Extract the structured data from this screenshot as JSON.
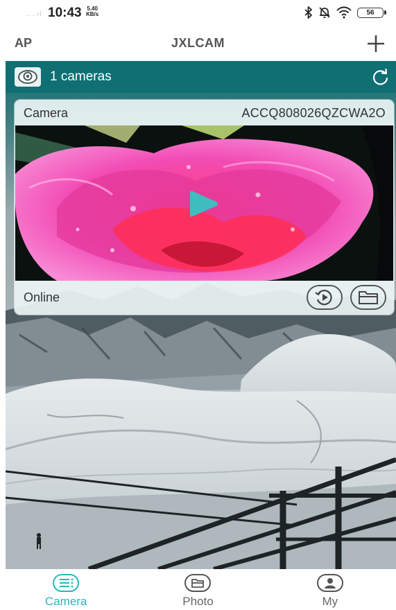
{
  "status_bar": {
    "signal": "....ıl",
    "time": "10:43",
    "speed_value": "5.40",
    "speed_unit": "KB/s",
    "battery": "56"
  },
  "header": {
    "left_label": "AP",
    "title": "JXLCAM",
    "add_icon": "plus-icon"
  },
  "banner": {
    "camera_icon": "camera-icon",
    "count_label": "1 cameras",
    "refresh_icon": "refresh-icon"
  },
  "camera_card": {
    "name": "Camera",
    "device_id": "ACCQ808026QZCWA2O",
    "status": "Online",
    "play_icon": "play-icon",
    "playback_icon": "playback-icon",
    "files_icon": "folder-icon"
  },
  "bottom_nav": {
    "items": [
      {
        "label": "Camera",
        "icon": "camera-list-icon",
        "active": true
      },
      {
        "label": "Photo",
        "icon": "photo-folder-icon",
        "active": false
      },
      {
        "label": "My",
        "icon": "user-icon",
        "active": false
      }
    ]
  },
  "colors": {
    "accent": "#2bb5bd",
    "banner": "#0f6f73",
    "text": "#333333"
  }
}
